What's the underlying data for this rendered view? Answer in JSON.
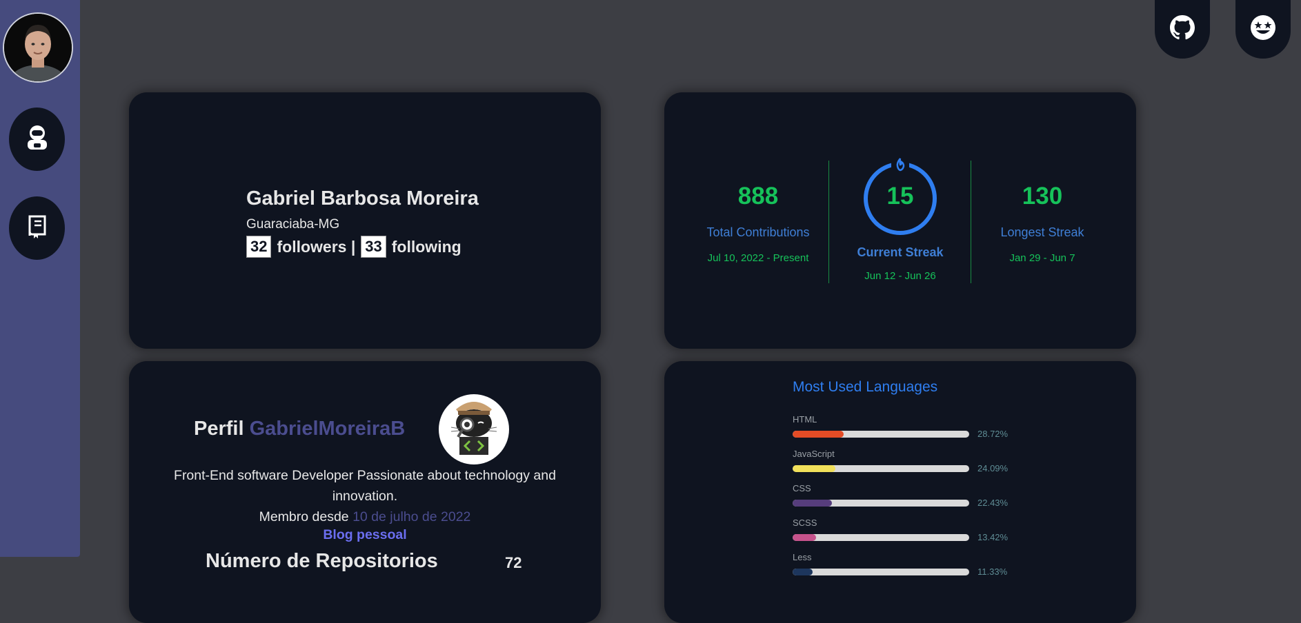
{
  "sidebar": {
    "avatar_alt": "profile photo",
    "buttons": [
      {
        "icon": "robot-icon"
      },
      {
        "icon": "book-icon"
      }
    ]
  },
  "top_buttons": [
    {
      "icon": "github-icon"
    },
    {
      "icon": "star-struck-face-icon"
    }
  ],
  "profile": {
    "name": "Gabriel Barbosa Moreira",
    "location": "Guaraciaba-MG",
    "followers_count": "32",
    "followers_label": "followers |",
    "following_count": "33",
    "following_label": "following"
  },
  "streak": {
    "total_contributions": "888",
    "total_label": "Total Contributions",
    "total_range": "Jul 10, 2022 - Present",
    "current_streak": "15",
    "current_label": "Current Streak",
    "current_range": "Jun 12 - Jun 26",
    "longest_streak": "130",
    "longest_label": "Longest Streak",
    "longest_range": "Jan 29 - Jun 7",
    "colors": {
      "value": "#16c25a",
      "label": "#3f7fd6",
      "ring": "#2f7ef0"
    }
  },
  "perfil": {
    "title_prefix": "Perfil",
    "username": "GabrielMoreiraB",
    "description": "Front-End software Developer Passionate about technology and innovation.",
    "member_prefix": "Membro desde",
    "member_since": "10 de julho de 2022",
    "blog_link": "Blog pessoal",
    "repos_label": "Número de Repositorios",
    "repos_count": "72"
  },
  "languages": {
    "title": "Most Used Languages",
    "items": [
      {
        "name": "HTML",
        "percent": 28.72,
        "percent_label": "28.72%",
        "color": "#e34c26"
      },
      {
        "name": "JavaScript",
        "percent": 24.09,
        "percent_label": "24.09%",
        "color": "#f1e05a"
      },
      {
        "name": "CSS",
        "percent": 22.43,
        "percent_label": "22.43%",
        "color": "#563d7c"
      },
      {
        "name": "SCSS",
        "percent": 13.42,
        "percent_label": "13.42%",
        "color": "#c6538c"
      },
      {
        "name": "Less",
        "percent": 11.33,
        "percent_label": "11.33%",
        "color": "#1d365d"
      }
    ]
  }
}
